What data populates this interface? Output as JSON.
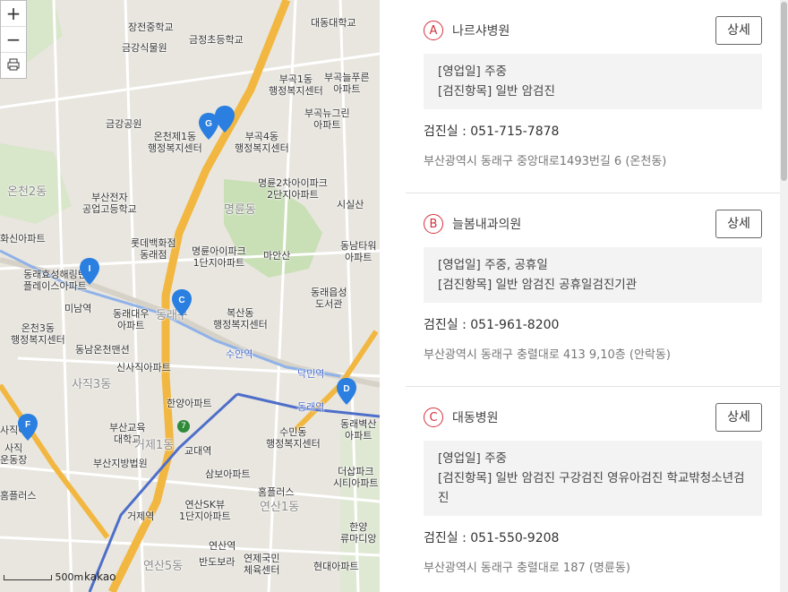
{
  "map": {
    "zoom_in": "+",
    "zoom_out": "−",
    "print": "print-icon",
    "scale": "500m",
    "brand": "kakao",
    "labels": {
      "jangjeon_middle": "장전중학교",
      "daedong_univ": "대동대학교",
      "geumjeong_elem": "금정초등학교",
      "geumgang_garden": "금강식물원",
      "bugok1": "부곡1동\n행정복지센터",
      "bugok_neulpureun": "부곡늘푸른\n아파트",
      "geumgang_park": "금강공원",
      "oncheon1": "온천제1동\n행정복지센터",
      "bugok4": "부곡4동\n행정복지센터",
      "bugok_newtown": "부곡뉴그린\n아파트",
      "busan_tech": "부산전자\n공업고등학교",
      "myeongnyun_2cha": "명륜2차아이파크\n2단지아파트",
      "sisilsan": "시실산",
      "oncheon2": "온천2동",
      "myeongnyun_dong": "명륜동",
      "hwasin_apt": "화신아파트",
      "lotte_dept": "롯데백화점\n동래점",
      "myeongnyun_ipark": "명륜아이파크\n1단지아파트",
      "masan": "마안산",
      "dongnam_tower": "동남타워\n아파트",
      "dongrae_hyoseong": "동래효성해링턴\n플레이스아파트",
      "dongrae_library": "동래읍성\n도서관",
      "minam_stn": "미남역",
      "dongrae_daewoo": "동래대우\n아파트",
      "dongrae_gu": "동래구",
      "boksan": "복산동\n행정복지센터",
      "oncheon3": "온천3동\n행정복지센터",
      "dongnam_oncheon": "동남온천맨션",
      "suan_stn": "수안역",
      "sinsajik": "신사직아파트",
      "nakmin_stn": "낙민역",
      "sajik3": "사직3동",
      "hanyang_apt": "한양아파트",
      "dongrae_stn": "동래역",
      "dongrae_byeoksan": "동래벽산\n아파트",
      "sajik_i": "사직이",
      "busan_edu_univ": "부산교육\n대학교",
      "sumin": "수민동\n행정복지센터",
      "sajik_stadium": "사직\n운동장",
      "gyodae_stn": "교대역",
      "busan_court": "부산지방법원",
      "sambo_apt": "삼보아파트",
      "deoksan_city": "더삽파크\n시티아파트",
      "homeplus1": "홈플러스",
      "homeplus2": "홈플러스",
      "yeonsan_sk": "연산SK뷰\n1단지아파트",
      "geoje_stn": "거제역",
      "hanyang_lumidia": "한양\n류마디앙",
      "yeonsan_stn": "연산역",
      "bandoborah": "반도보라",
      "yeonje_gym": "연제국민\n체육센터",
      "hyundai_apt": "현대아파트",
      "yeonsan1": "연산1동",
      "yeonsan5": "연산5동",
      "geoje1": "거제1동",
      "road7": "7"
    },
    "markers": [
      "G",
      "I",
      "C",
      "D",
      "F"
    ]
  },
  "hospitals": [
    {
      "letter": "A",
      "name": "나르샤병원",
      "detail_label": "상세",
      "hours": "[영업일] 주중",
      "items": "[검진항목] 일반 암검진",
      "phone": "검진실 :  051-715-7878",
      "address": "부산광역시 동래구 중앙대로1493번길 6 (온천동)"
    },
    {
      "letter": "B",
      "name": "늘봄내과의원",
      "detail_label": "상세",
      "hours": "[영업일] 주중, 공휴일",
      "items": "[검진항목] 일반 암검진 공휴일검진기관",
      "phone": "검진실 :  051-961-8200",
      "address": "부산광역시 동래구 충렬대로 413 9,10층 (안락동)"
    },
    {
      "letter": "C",
      "name": "대동병원",
      "detail_label": "상세",
      "hours": "[영업일] 주중",
      "items": "[검진항목] 일반 암검진 구강검진 영유아검진 학교밖청소년검진",
      "phone": "검진실 :  051-550-9208",
      "address": "부산광역시 동래구 충렬대로 187 (명륜동)"
    }
  ],
  "colors": {
    "accent": "#d6313c",
    "marker": "#2a7fe0",
    "main_road": "#f2b740",
    "subway": "#4d6ec9"
  }
}
